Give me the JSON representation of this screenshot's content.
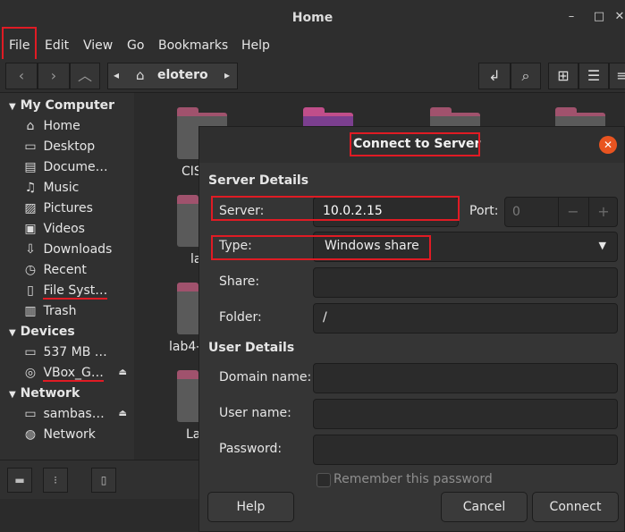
{
  "window": {
    "title": "Home"
  },
  "menu": [
    "File",
    "Edit",
    "View",
    "Go",
    "Bookmarks",
    "Help"
  ],
  "breadcrumb": {
    "location": "elotero"
  },
  "sidebar": {
    "sections": [
      {
        "title": "My Computer",
        "items": [
          {
            "label": "Home",
            "icon": "home-icon"
          },
          {
            "label": "Desktop",
            "icon": "desktop-icon"
          },
          {
            "label": "Docume…",
            "icon": "documents-icon"
          },
          {
            "label": "Music",
            "icon": "music-icon"
          },
          {
            "label": "Pictures",
            "icon": "pictures-icon"
          },
          {
            "label": "Videos",
            "icon": "videos-icon"
          },
          {
            "label": "Downloads",
            "icon": "downloads-icon"
          },
          {
            "label": "Recent",
            "icon": "recent-icon"
          },
          {
            "label": "File Syst…",
            "icon": "filesystem-icon"
          },
          {
            "label": "Trash",
            "icon": "trash-icon"
          }
        ]
      },
      {
        "title": "Devices",
        "items": [
          {
            "label": "537 MB …",
            "icon": "drive-icon"
          },
          {
            "label": "VBox_G…",
            "icon": "disc-icon"
          }
        ]
      },
      {
        "title": "Network",
        "items": [
          {
            "label": "sambas…",
            "icon": "network-share-icon"
          },
          {
            "label": "Network",
            "icon": "globe-icon"
          }
        ]
      }
    ]
  },
  "folders": [
    "CIS",
    "la",
    "lab4-",
    "La"
  ],
  "dialog": {
    "title": "Connect to Server",
    "server_details_heading": "Server Details",
    "server_label": "Server:",
    "server_value": "10.0.2.15",
    "port_label": "Port:",
    "port_value": "0",
    "type_label": "Type:",
    "type_value": "Windows share",
    "share_label": "Share:",
    "folder_label": "Folder:",
    "folder_value": "/",
    "user_details_heading": "User Details",
    "domain_label": "Domain name:",
    "username_label": "User name:",
    "password_label": "Password:",
    "remember_label": "Remember this password",
    "help_button": "Help",
    "cancel_button": "Cancel",
    "connect_button": "Connect"
  },
  "colors": {
    "accent": "#e95420",
    "highlight": "#e01b24",
    "folder": "#a0526d"
  }
}
